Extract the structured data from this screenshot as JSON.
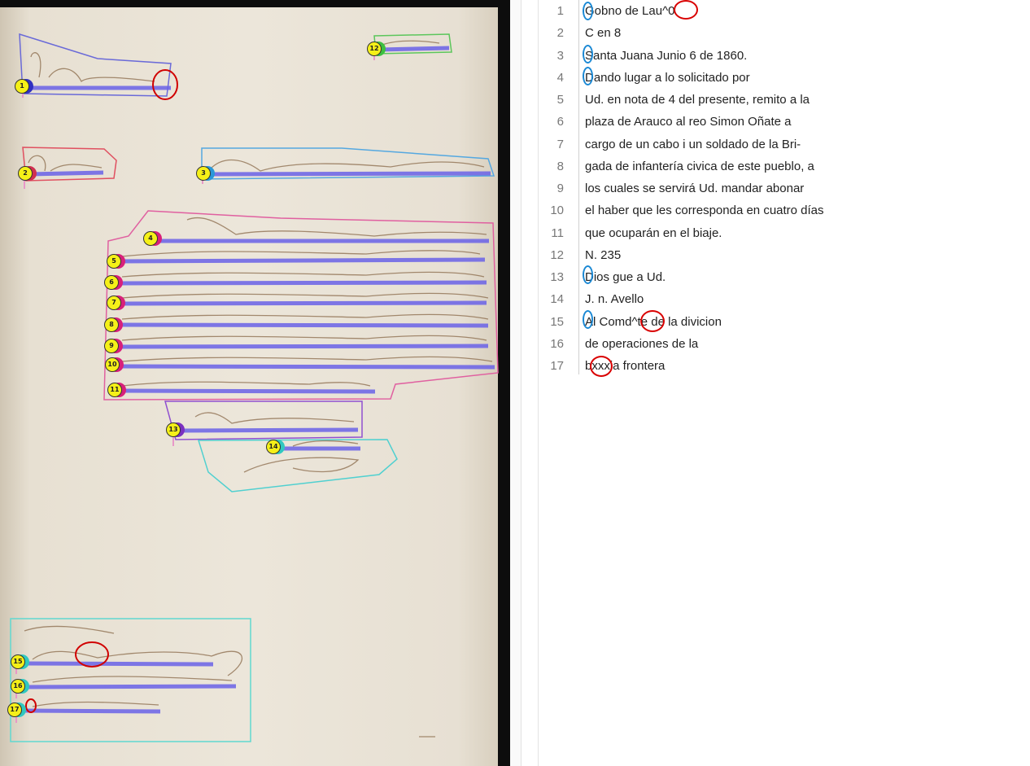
{
  "document": {
    "region_labels": [
      {
        "id": "1",
        "color": "#3030c0"
      },
      {
        "id": "2",
        "color": "#d03050"
      },
      {
        "id": "3",
        "color": "#2a98d8"
      },
      {
        "id": "4",
        "color": "#d8207a"
      },
      {
        "id": "5",
        "color": "#d8207a"
      },
      {
        "id": "6",
        "color": "#d8207a"
      },
      {
        "id": "7",
        "color": "#d8207a"
      },
      {
        "id": "8",
        "color": "#d8207a"
      },
      {
        "id": "9",
        "color": "#d8207a"
      },
      {
        "id": "10",
        "color": "#d8207a"
      },
      {
        "id": "11",
        "color": "#d8207a"
      },
      {
        "id": "12",
        "color": "#3cc040"
      },
      {
        "id": "13",
        "color": "#7a30c0"
      },
      {
        "id": "14",
        "color": "#30c8c0"
      },
      {
        "id": "15",
        "color": "#30c8c0"
      },
      {
        "id": "16",
        "color": "#30c8c0"
      },
      {
        "id": "17",
        "color": "#30c8c0"
      }
    ]
  },
  "transcription": {
    "lines": [
      {
        "n": "1",
        "text": "Gobno de Lau^0"
      },
      {
        "n": "2",
        "text": "C en 8"
      },
      {
        "n": "3",
        "text": "Santa Juana Junio 6 de 1860."
      },
      {
        "n": "4",
        "text": "Dando lugar a lo solicitado por"
      },
      {
        "n": "5",
        "text": "Ud. en nota de 4 del presente, remito a la"
      },
      {
        "n": "6",
        "text": "plaza de Arauco al reo Simon Oñate a"
      },
      {
        "n": "7",
        "text": "cargo de un cabo i un soldado de la Bri-"
      },
      {
        "n": "8",
        "text": "gada de infantería civica de este pueblo, a"
      },
      {
        "n": "9",
        "text": "los cuales se servirá Ud. mandar abonar"
      },
      {
        "n": "10",
        "text": "el haber que les corresponda en cuatro días"
      },
      {
        "n": "11",
        "text": "que ocuparán en el biaje."
      },
      {
        "n": "12",
        "text": "N. 235"
      },
      {
        "n": "13",
        "text": "Dios gue a Ud."
      },
      {
        "n": "14",
        "text": "J. n. Avello"
      },
      {
        "n": "15",
        "text": "Al Comd^te de la divicion"
      },
      {
        "n": "16",
        "text": "de operaciones de la"
      },
      {
        "n": "17",
        "text": "bxxxia frontera"
      }
    ]
  }
}
